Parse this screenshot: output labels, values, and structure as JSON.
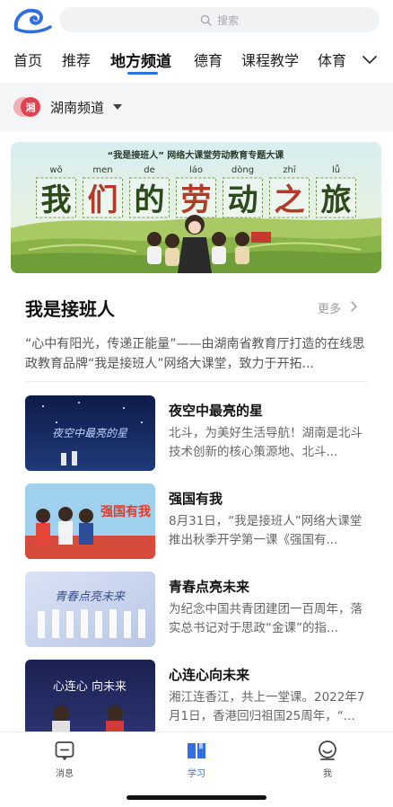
{
  "search": {
    "placeholder": "搜索",
    "icon": "search-icon"
  },
  "tabs": [
    {
      "label": "首页",
      "active": false
    },
    {
      "label": "推荐",
      "active": false
    },
    {
      "label": "地方频道",
      "active": true
    },
    {
      "label": "德育",
      "active": false
    },
    {
      "label": "课程教学",
      "active": false
    },
    {
      "label": "体育",
      "active": false
    }
  ],
  "region": {
    "badge": "湘",
    "label": "湖南频道"
  },
  "banner": {
    "subtitle": "“我是接班人” 网络大课堂劳动教育专题大课",
    "pinyin": [
      "wǒ",
      "men",
      "de",
      "láo",
      "dòng",
      "zhī",
      "lǚ"
    ],
    "title_chars": [
      "我",
      "们",
      "的",
      "劳",
      "动",
      "之",
      "旅"
    ]
  },
  "section": {
    "title": "我是接班人",
    "more": "更多",
    "description": "“心中有阳光，传递正能量”——由湖南省教育厅打造的在线思政教育品牌“我是接班人”网络大课堂，致力于开拓..."
  },
  "items": [
    {
      "title": "夜空中最亮的星",
      "desc": "北斗，为美好生活导航！湖南是北斗技术创新的核心策源地、北斗...",
      "thumb_text": "夜空中最亮的星"
    },
    {
      "title": "强国有我",
      "desc": "8月31日，“我是接班人”网络大课堂推出秋季开学第一课《强国有...",
      "thumb_text": "强国有我"
    },
    {
      "title": "青春点亮未来",
      "desc": "为纪念中国共青团建团一百周年，落实总书记对于思政“金课”的指...",
      "thumb_text": "青春点亮未来"
    },
    {
      "title": "心连心向未来",
      "desc": "湘江连香江，共上一堂课。2022年7月1日，香港回归祖国25周年，“...",
      "thumb_text": "心连心 向未来"
    }
  ],
  "nav": [
    {
      "label": "消息",
      "icon": "message-icon",
      "active": false
    },
    {
      "label": "学习",
      "icon": "book-icon",
      "active": true
    },
    {
      "label": "我",
      "icon": "profile-icon",
      "active": false
    }
  ],
  "colors": {
    "accent": "#2f6fe0",
    "banner_sky": "#cfe7ea",
    "banner_hills": "#8fb94a"
  }
}
